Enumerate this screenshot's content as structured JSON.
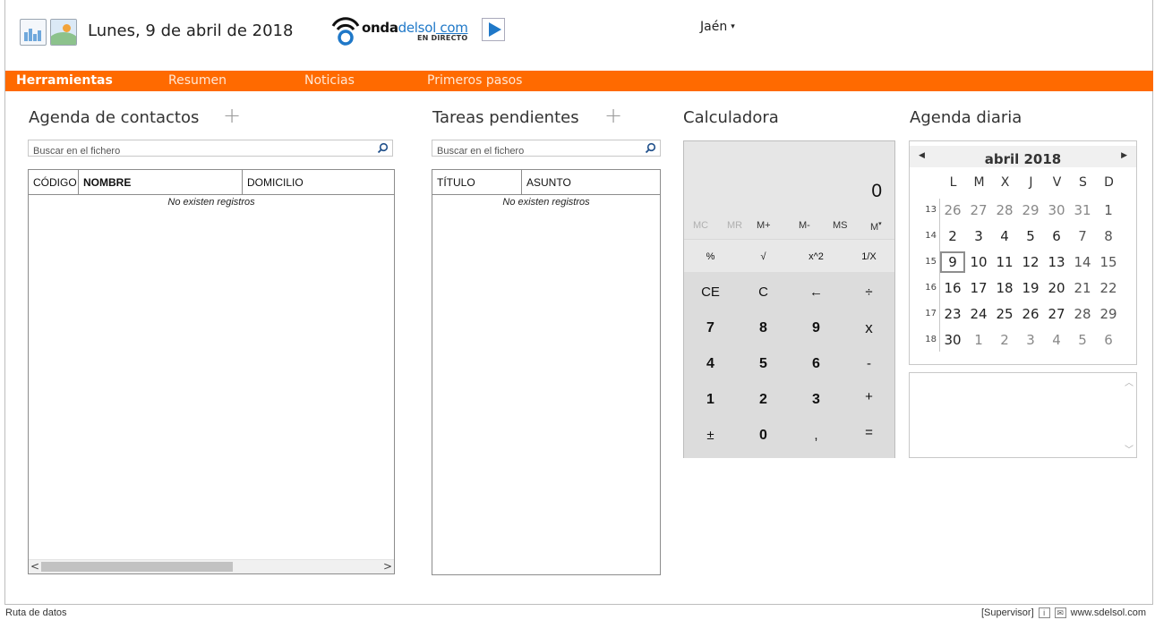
{
  "header": {
    "date": "Lunes, 9 de abril de 2018",
    "radio_bold": "onda",
    "radio_blue": "delsol",
    "radio_domain": " com",
    "radio_live": "EN DIRECTO",
    "location": "Jaén",
    "location_caret": "▾"
  },
  "nav": {
    "items": [
      {
        "label": "Herramientas"
      },
      {
        "label": "Resumen"
      },
      {
        "label": "Noticias"
      },
      {
        "label": "Primeros pasos"
      }
    ],
    "active_index": 0
  },
  "contacts": {
    "title": "Agenda de contactos",
    "add": "+",
    "search_placeholder": "Buscar en el fichero",
    "columns": [
      "CÓDIGO",
      "NOMBRE",
      "DOMICILIO"
    ],
    "empty": "No existen registros",
    "scroll_left": "<",
    "scroll_right": ">"
  },
  "tasks": {
    "title": "Tareas pendientes",
    "add": "+",
    "search_placeholder": "Buscar en el fichero",
    "columns": [
      "TÍTULO",
      "ASUNTO"
    ],
    "empty": "No existen registros"
  },
  "calculator": {
    "title": "Calculadora",
    "display": "0",
    "memory": [
      "MC",
      "MR",
      "M+",
      "M-",
      "MS",
      "M"
    ],
    "memory_dot": "▾",
    "functions": [
      "%",
      "√",
      "x^2",
      "1/X"
    ],
    "keys": [
      [
        "CE",
        "C",
        "←",
        "÷"
      ],
      [
        "7",
        "8",
        "9",
        "x"
      ],
      [
        "4",
        "5",
        "6",
        "-"
      ],
      [
        "1",
        "2",
        "3",
        "+"
      ],
      [
        "±",
        "0",
        ",",
        "="
      ]
    ]
  },
  "calendar": {
    "title": "Agenda diaria",
    "month": "abril 2018",
    "prev": "◀",
    "next": "▶",
    "weekdays": [
      "L",
      "M",
      "X",
      "J",
      "V",
      "S",
      "D"
    ],
    "week_numbers": [
      "13",
      "14",
      "15",
      "16",
      "17",
      "18"
    ],
    "weeks": [
      [
        "26",
        "27",
        "28",
        "29",
        "30",
        "31",
        "1"
      ],
      [
        "2",
        "3",
        "4",
        "5",
        "6",
        "7",
        "8"
      ],
      [
        "9",
        "10",
        "11",
        "12",
        "13",
        "14",
        "15"
      ],
      [
        "16",
        "17",
        "18",
        "19",
        "20",
        "21",
        "22"
      ],
      [
        "23",
        "24",
        "25",
        "26",
        "27",
        "28",
        "29"
      ],
      [
        "30",
        "1",
        "2",
        "3",
        "4",
        "5",
        "6"
      ]
    ],
    "selected": "9"
  },
  "notes": {
    "scroll_up": "︿",
    "scroll_down": "﹀"
  },
  "status": {
    "left": "Ruta de datos",
    "user": "[Supervisor]",
    "info_icon": "i",
    "mail_icon": "✉",
    "site": "www.sdelsol.com"
  },
  "colors": {
    "nav_orange": "#ff6a00",
    "brand_blue": "#1f78c8"
  }
}
